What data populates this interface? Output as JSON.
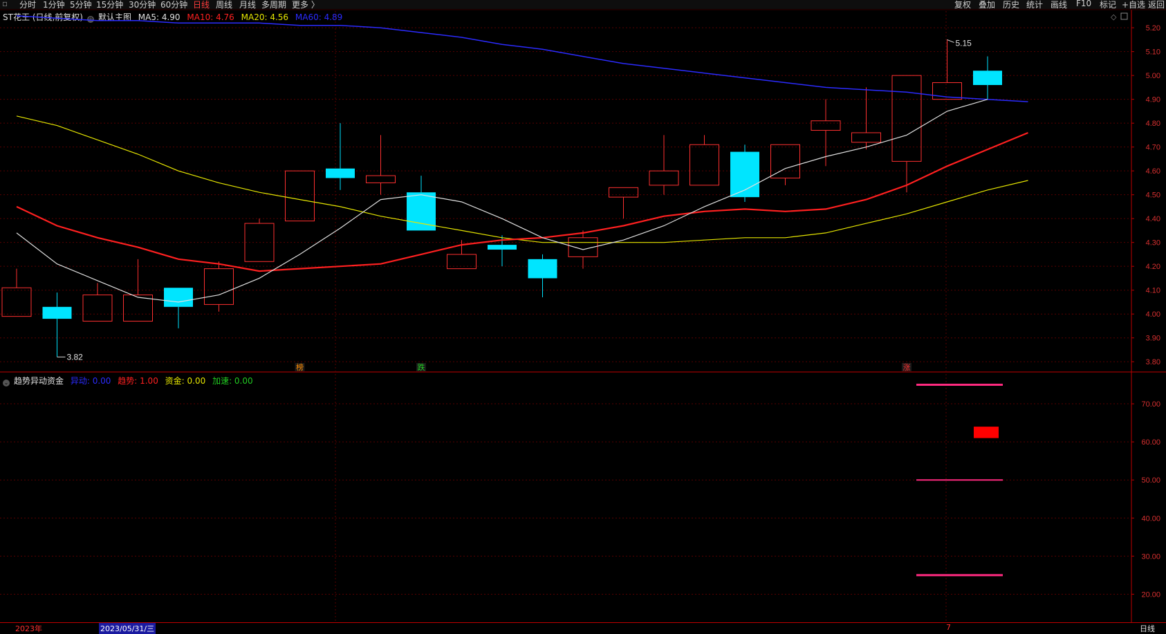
{
  "toolbar": {
    "periods": [
      "分时",
      "1分钟",
      "5分钟",
      "15分钟",
      "30分钟",
      "60分钟",
      "日线",
      "周线",
      "月线",
      "多周期",
      "更多 〉"
    ],
    "active_period": "日线",
    "right_buttons": [
      "复权",
      "叠加",
      "历史",
      "统计",
      "画线",
      "F10",
      "标记",
      "+自选",
      "返回"
    ]
  },
  "main_chart": {
    "stock_title": "ST花王 (日线,前复权)",
    "main_chart_label": "默认主图",
    "ma": [
      {
        "label": "MA5: 4.90",
        "color": "#e0e0e0"
      },
      {
        "label": "MA10: 4.76",
        "color": "#ff2020"
      },
      {
        "label": "MA20: 4.56",
        "color": "#e6e600"
      },
      {
        "label": "MA60: 4.89",
        "color": "#2b2bff"
      }
    ],
    "high_label": "5.15",
    "low_label": "3.82",
    "price_ticks": [
      "5.20",
      "5.10",
      "5.00",
      "4.90",
      "4.80",
      "4.70",
      "4.60",
      "4.50",
      "4.40",
      "4.30",
      "4.20",
      "4.10",
      "4.00",
      "3.90",
      "3.80"
    ],
    "markers": [
      {
        "text": "榜",
        "color": "#ff8c00"
      },
      {
        "text": "跌",
        "color": "#22cc22"
      },
      {
        "text": "涨",
        "color": "#ff3030"
      }
    ]
  },
  "lower_chart": {
    "indicator_name": "趋势异动资金",
    "values": [
      {
        "label": "异动: 0.00",
        "color": "#2b2bff"
      },
      {
        "label": "趋势: 1.00",
        "color": "#ff2020"
      },
      {
        "label": "资金: 0.00",
        "color": "#e6e600"
      },
      {
        "label": "加速: 0.00",
        "color": "#22cc22"
      }
    ],
    "ticks": [
      "70.00",
      "60.00",
      "50.00",
      "40.00",
      "30.00",
      "20.00"
    ]
  },
  "bottom_bar": {
    "year": "2023年",
    "cursor_date": "2023/05/31/三",
    "month_marker": "7",
    "period": "日线"
  },
  "chart_data": {
    "type": "candlestick",
    "candles": [
      {
        "o": 3.99,
        "h": 4.19,
        "l": 3.99,
        "c": 4.11
      },
      {
        "o": 4.03,
        "h": 4.09,
        "l": 3.82,
        "c": 3.98
      },
      {
        "o": 3.97,
        "h": 4.13,
        "l": 3.97,
        "c": 4.08
      },
      {
        "o": 3.97,
        "h": 4.23,
        "l": 3.97,
        "c": 4.08
      },
      {
        "o": 4.11,
        "h": 4.11,
        "l": 3.94,
        "c": 4.03
      },
      {
        "o": 4.04,
        "h": 4.22,
        "l": 4.01,
        "c": 4.19
      },
      {
        "o": 4.22,
        "h": 4.4,
        "l": 4.22,
        "c": 4.38
      },
      {
        "o": 4.39,
        "h": 4.6,
        "l": 4.39,
        "c": 4.6
      },
      {
        "o": 4.61,
        "h": 4.8,
        "l": 4.52,
        "c": 4.57
      },
      {
        "o": 4.55,
        "h": 4.75,
        "l": 4.5,
        "c": 4.58
      },
      {
        "o": 4.51,
        "h": 4.58,
        "l": 4.35,
        "c": 4.35
      },
      {
        "o": 4.19,
        "h": 4.31,
        "l": 4.19,
        "c": 4.25
      },
      {
        "o": 4.29,
        "h": 4.33,
        "l": 4.2,
        "c": 4.27
      },
      {
        "o": 4.23,
        "h": 4.25,
        "l": 4.07,
        "c": 4.15
      },
      {
        "o": 4.24,
        "h": 4.35,
        "l": 4.19,
        "c": 4.32
      },
      {
        "o": 4.49,
        "h": 4.53,
        "l": 4.4,
        "c": 4.53
      },
      {
        "o": 4.54,
        "h": 4.75,
        "l": 4.5,
        "c": 4.6
      },
      {
        "o": 4.54,
        "h": 4.75,
        "l": 4.54,
        "c": 4.71
      },
      {
        "o": 4.68,
        "h": 4.71,
        "l": 4.47,
        "c": 4.49
      },
      {
        "o": 4.57,
        "h": 4.71,
        "l": 4.54,
        "c": 4.71
      },
      {
        "o": 4.77,
        "h": 4.9,
        "l": 4.62,
        "c": 4.81
      },
      {
        "o": 4.72,
        "h": 4.95,
        "l": 4.69,
        "c": 4.76
      },
      {
        "o": 4.64,
        "h": 5.0,
        "l": 4.51,
        "c": 5.0
      },
      {
        "o": 4.9,
        "h": 5.15,
        "l": 4.9,
        "c": 4.97
      },
      {
        "o": 5.02,
        "h": 5.08,
        "l": 4.9,
        "c": 4.96
      }
    ],
    "ma5": [
      4.34,
      4.21,
      4.14,
      4.07,
      4.05,
      4.08,
      4.15,
      4.25,
      4.36,
      4.48,
      4.5,
      4.47,
      4.4,
      4.32,
      4.27,
      4.31,
      4.37,
      4.45,
      4.52,
      4.61,
      4.66,
      4.7,
      4.75,
      4.85,
      4.9
    ],
    "ma10": [
      4.45,
      4.37,
      4.32,
      4.28,
      4.23,
      4.21,
      4.18,
      4.19,
      4.2,
      4.21,
      4.25,
      4.29,
      4.31,
      4.32,
      4.34,
      4.37,
      4.41,
      4.43,
      4.44,
      4.43,
      4.44,
      4.48,
      4.54,
      4.62,
      4.69,
      4.76
    ],
    "ma20": [
      4.83,
      4.79,
      4.73,
      4.67,
      4.6,
      4.55,
      4.51,
      4.48,
      4.45,
      4.41,
      4.38,
      4.35,
      4.32,
      4.3,
      4.3,
      4.3,
      4.3,
      4.31,
      4.32,
      4.32,
      4.34,
      4.38,
      4.42,
      4.47,
      4.52,
      4.56
    ],
    "ma60": [
      5.25,
      5.24,
      5.23,
      5.23,
      5.22,
      5.22,
      5.22,
      5.21,
      5.21,
      5.2,
      5.18,
      5.16,
      5.13,
      5.11,
      5.08,
      5.05,
      5.03,
      5.01,
      4.99,
      4.97,
      4.95,
      4.94,
      4.93,
      4.91,
      4.9,
      4.89
    ],
    "price_range": [
      3.76,
      5.27
    ],
    "indicator": {
      "range": [
        13,
        78
      ],
      "pink_lines": [
        75,
        50,
        25
      ],
      "red_bar": [
        61,
        64
      ]
    }
  }
}
